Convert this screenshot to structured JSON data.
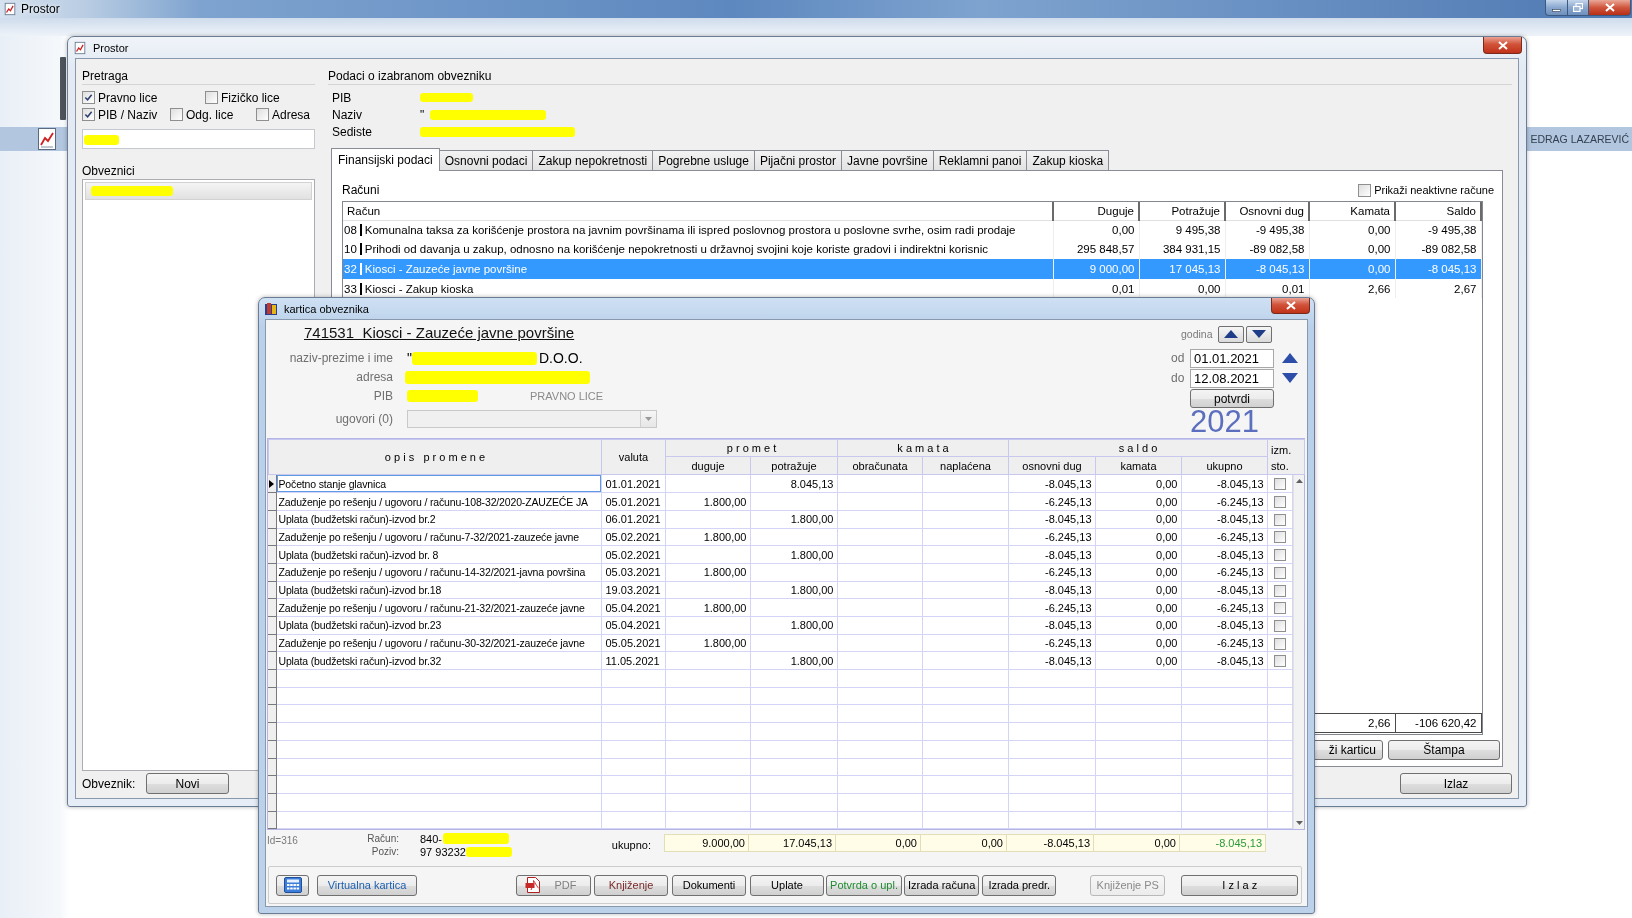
{
  "app": {
    "title": "Prostor",
    "user_name": "EDRAG LAZAREVIĆ"
  },
  "prostor": {
    "title": "Prostor",
    "search": {
      "heading": "Pretraga",
      "option_rows": [
        [
          {
            "label": "Pravno lice",
            "checked": true
          },
          {
            "label": "Fizičko lice",
            "checked": false
          }
        ],
        [
          {
            "label": "PIB / Naziv",
            "checked": true
          },
          {
            "label": "Odg. lice",
            "checked": false
          },
          {
            "label": "Adresa",
            "checked": false
          }
        ]
      ],
      "query_redacted": true
    },
    "taxpayers": {
      "heading": "Obveznici",
      "items": [
        {
          "redacted": true,
          "selected": true
        }
      ]
    },
    "footer": {
      "label": "Obveznik:",
      "buttons": [
        "Novi"
      ]
    },
    "details": {
      "heading": "Podaci o izabranom obvezniku",
      "fields": [
        {
          "label": "PIB",
          "redacted": true
        },
        {
          "label": "Naziv",
          "value_start": "\"",
          "redacted": true
        },
        {
          "label": "Sediste",
          "redacted": true
        }
      ]
    },
    "tabs": [
      {
        "label": "Finansijski podaci",
        "selected": true
      },
      {
        "label": "Osnovni podaci",
        "selected": false
      },
      {
        "label": "Zakup nepokretnosti",
        "selected": false
      },
      {
        "label": "Pogrebne usluge",
        "selected": false
      },
      {
        "label": "Pijačni prostor",
        "selected": false
      },
      {
        "label": "Javne površine",
        "selected": false
      },
      {
        "label": "Reklamni panoi",
        "selected": false
      },
      {
        "label": "Zakup kioska",
        "selected": false
      }
    ],
    "accounts": {
      "label": "Računi",
      "show_inactive": {
        "label": "Prikaži neaktivne račune",
        "checked": false
      },
      "columns": [
        "Račun",
        "Duguje",
        "Potražuje",
        "Osnovni dug",
        "Kamata",
        "Saldo"
      ],
      "rows": [
        {
          "code": "08",
          "name": "Komunalna taksa za korišćenje prostora na javnim površinama ili ispred poslovnog prostora u poslovne svrhe, osim radi prodaje",
          "duguje": "0,00",
          "potrazuje": "9 495,38",
          "osnovni_dug": "-9 495,38",
          "kamata": "0,00",
          "saldo": "-9 495,38",
          "selected": false
        },
        {
          "code": "10",
          "name": "Prihodi od davanja u zakup, odnosno na korišćenje nepokretnosti u državnoj svojini koje koriste gradovi i indirektni korisnic",
          "duguje": "295 848,57",
          "potrazuje": "384 931,15",
          "osnovni_dug": "-89 082,58",
          "kamata": "0,00",
          "saldo": "-89 082,58",
          "selected": false
        },
        {
          "code": "32",
          "name": "Kiosci - Zauzeće javne površine",
          "duguje": "9 000,00",
          "potrazuje": "17 045,13",
          "osnovni_dug": "-8 045,13",
          "kamata": "0,00",
          "saldo": "-8 045,13",
          "selected": true
        },
        {
          "code": "33",
          "name": "Kiosci - Zakup kioska",
          "duguje": "0,01",
          "potrazuje": "0,00",
          "osnovni_dug": "0,01",
          "kamata": "2,66",
          "saldo": "2,67",
          "selected": false
        }
      ],
      "totals": {
        "kamata": "2,66",
        "saldo": "-106 620,42"
      }
    },
    "panel_buttons": [
      "ži karticu",
      "Štampa"
    ],
    "exit_button": "Izlaz"
  },
  "kartica": {
    "title": "kartica obveznika",
    "heading": "741531  Kiosci - Zauzeće javne površine",
    "fields": [
      {
        "label": "naziv-prezime i ime",
        "value_start": "\"",
        "redacted": true,
        "value_end": "D.O.O."
      },
      {
        "label": "adresa",
        "redacted": true
      },
      {
        "label": "PIB",
        "redacted": true,
        "note": "PRAVNO LICE"
      }
    ],
    "contracts": {
      "label": "ugovori (0)",
      "disabled": true
    },
    "year": {
      "label": "godina",
      "value": "2021"
    },
    "period": [
      {
        "label": "od",
        "value": "01.01.2021"
      },
      {
        "label": "do",
        "value": "12.08.2021"
      }
    ],
    "confirm_button": "potvrdi",
    "grid": {
      "columns": [
        "o p i s   p r o m e n e",
        "valuta"
      ],
      "groups": [
        {
          "label": "p r o m e t",
          "columns": [
            "duguje",
            "potražuje"
          ]
        },
        {
          "label": "k a m a t a",
          "columns": [
            "obračunata",
            "naplaćena"
          ]
        },
        {
          "label": "s a l d o",
          "columns": [
            "osnovni dug",
            "kamata",
            "ukupno"
          ]
        }
      ],
      "last_column": "izm. sto.",
      "rows": [
        {
          "opis": "Početno stanje glavnica",
          "valuta": "01.01.2021",
          "potrazuje": "8.045,13",
          "osnovni_dug": "-8.045,13",
          "kamata": "0,00",
          "ukupno": "-8.045,13",
          "changed": false,
          "selected": true
        },
        {
          "opis": "Zaduženje po rešenju / ugovoru / računu-108-32/2020-ZAUZEĆE JA",
          "valuta": "05.01.2021",
          "duguje": "1.800,00",
          "osnovni_dug": "-6.245,13",
          "kamata": "0,00",
          "ukupno": "-6.245,13",
          "changed": false,
          "selected": false
        },
        {
          "opis": "Uplata (budžetski račun)-izvod br.2",
          "valuta": "06.01.2021",
          "potrazuje": "1.800,00",
          "osnovni_dug": "-8.045,13",
          "kamata": "0,00",
          "ukupno": "-8.045,13",
          "changed": false,
          "selected": false
        },
        {
          "opis": "Zaduženje po rešenju / ugovoru / računu-7-32/2021-zauzeće javne",
          "valuta": "05.02.2021",
          "duguje": "1.800,00",
          "osnovni_dug": "-6.245,13",
          "kamata": "0,00",
          "ukupno": "-6.245,13",
          "changed": false,
          "selected": false
        },
        {
          "opis": "Uplata (budžetski račun)-izvod br. 8",
          "valuta": "05.02.2021",
          "potrazuje": "1.800,00",
          "osnovni_dug": "-8.045,13",
          "kamata": "0,00",
          "ukupno": "-8.045,13",
          "changed": false,
          "selected": false
        },
        {
          "opis": "Zaduženje po rešenju / ugovoru / računu-14-32/2021-javna površina",
          "valuta": "05.03.2021",
          "duguje": "1.800,00",
          "osnovni_dug": "-6.245,13",
          "kamata": "0,00",
          "ukupno": "-6.245,13",
          "changed": false,
          "selected": false
        },
        {
          "opis": "Uplata (budžetski račun)-izvod br.18",
          "valuta": "19.03.2021",
          "potrazuje": "1.800,00",
          "osnovni_dug": "-8.045,13",
          "kamata": "0,00",
          "ukupno": "-8.045,13",
          "changed": false,
          "selected": false
        },
        {
          "opis": "Zaduženje po rešenju / ugovoru / računu-21-32/2021-zauzeće javne",
          "valuta": "05.04.2021",
          "duguje": "1.800,00",
          "osnovni_dug": "-6.245,13",
          "kamata": "0,00",
          "ukupno": "-6.245,13",
          "changed": false,
          "selected": false
        },
        {
          "opis": "Uplata (budžetski račun)-izvod br.23",
          "valuta": "05.04.2021",
          "potrazuje": "1.800,00",
          "osnovni_dug": "-8.045,13",
          "kamata": "0,00",
          "ukupno": "-8.045,13",
          "changed": false,
          "selected": false
        },
        {
          "opis": "Zaduženje po rešenju / ugovoru / računu-30-32/2021-zauzeće javne",
          "valuta": "05.05.2021",
          "duguje": "1.800,00",
          "osnovni_dug": "-6.245,13",
          "kamata": "0,00",
          "ukupno": "-6.245,13",
          "changed": false,
          "selected": false
        },
        {
          "opis": "Uplata (budžetski račun)-izvod br.32",
          "valuta": "11.05.2021",
          "potrazuje": "1.800,00",
          "osnovni_dug": "-8.045,13",
          "kamata": "0,00",
          "ukupno": "-8.045,13",
          "changed": false,
          "selected": false
        }
      ]
    },
    "record_id": "Id=316",
    "references": [
      {
        "label": "Račun:",
        "value": "840-",
        "redacted": true
      },
      {
        "label": "Poziv:",
        "value": "97 93232",
        "redacted": true
      }
    ],
    "totals_label": "ukupno:",
    "totals": [
      {
        "value": "9.000,00"
      },
      {
        "value": "17.045,13"
      },
      {
        "value": "0,00"
      },
      {
        "value": "0,00"
      },
      {
        "value": "-8.045,13"
      },
      {
        "value": "0,00"
      },
      {
        "value": "-8.045,13",
        "color": "#2a9a3a"
      }
    ],
    "buttons": [
      {
        "kind": "calculator",
        "disabled": false
      },
      {
        "kind": "text",
        "label": "Virtualna kartica",
        "color": "#1c5fb0",
        "disabled": false
      },
      {
        "kind": "pdf",
        "label": "PDF",
        "color": "#808080",
        "disabled": false
      },
      {
        "kind": "text",
        "label": "Knjiženje",
        "color": "#7a2a2a",
        "disabled": false
      },
      {
        "kind": "text",
        "label": "Dokumenti",
        "disabled": false
      },
      {
        "kind": "text",
        "label": "Uplate",
        "disabled": false
      },
      {
        "kind": "text",
        "label": "Potvrda o upl.",
        "color": "#1e8c2e",
        "disabled": false
      },
      {
        "kind": "text",
        "label": "Izrada računa",
        "disabled": false
      },
      {
        "kind": "text",
        "label": "Izrada predr.",
        "disabled": false
      },
      {
        "kind": "text",
        "label": "Knjiženje PS",
        "color": "#8a8a8a",
        "disabled": true
      },
      {
        "kind": "text",
        "label": "I z l a z",
        "disabled": false
      }
    ]
  }
}
